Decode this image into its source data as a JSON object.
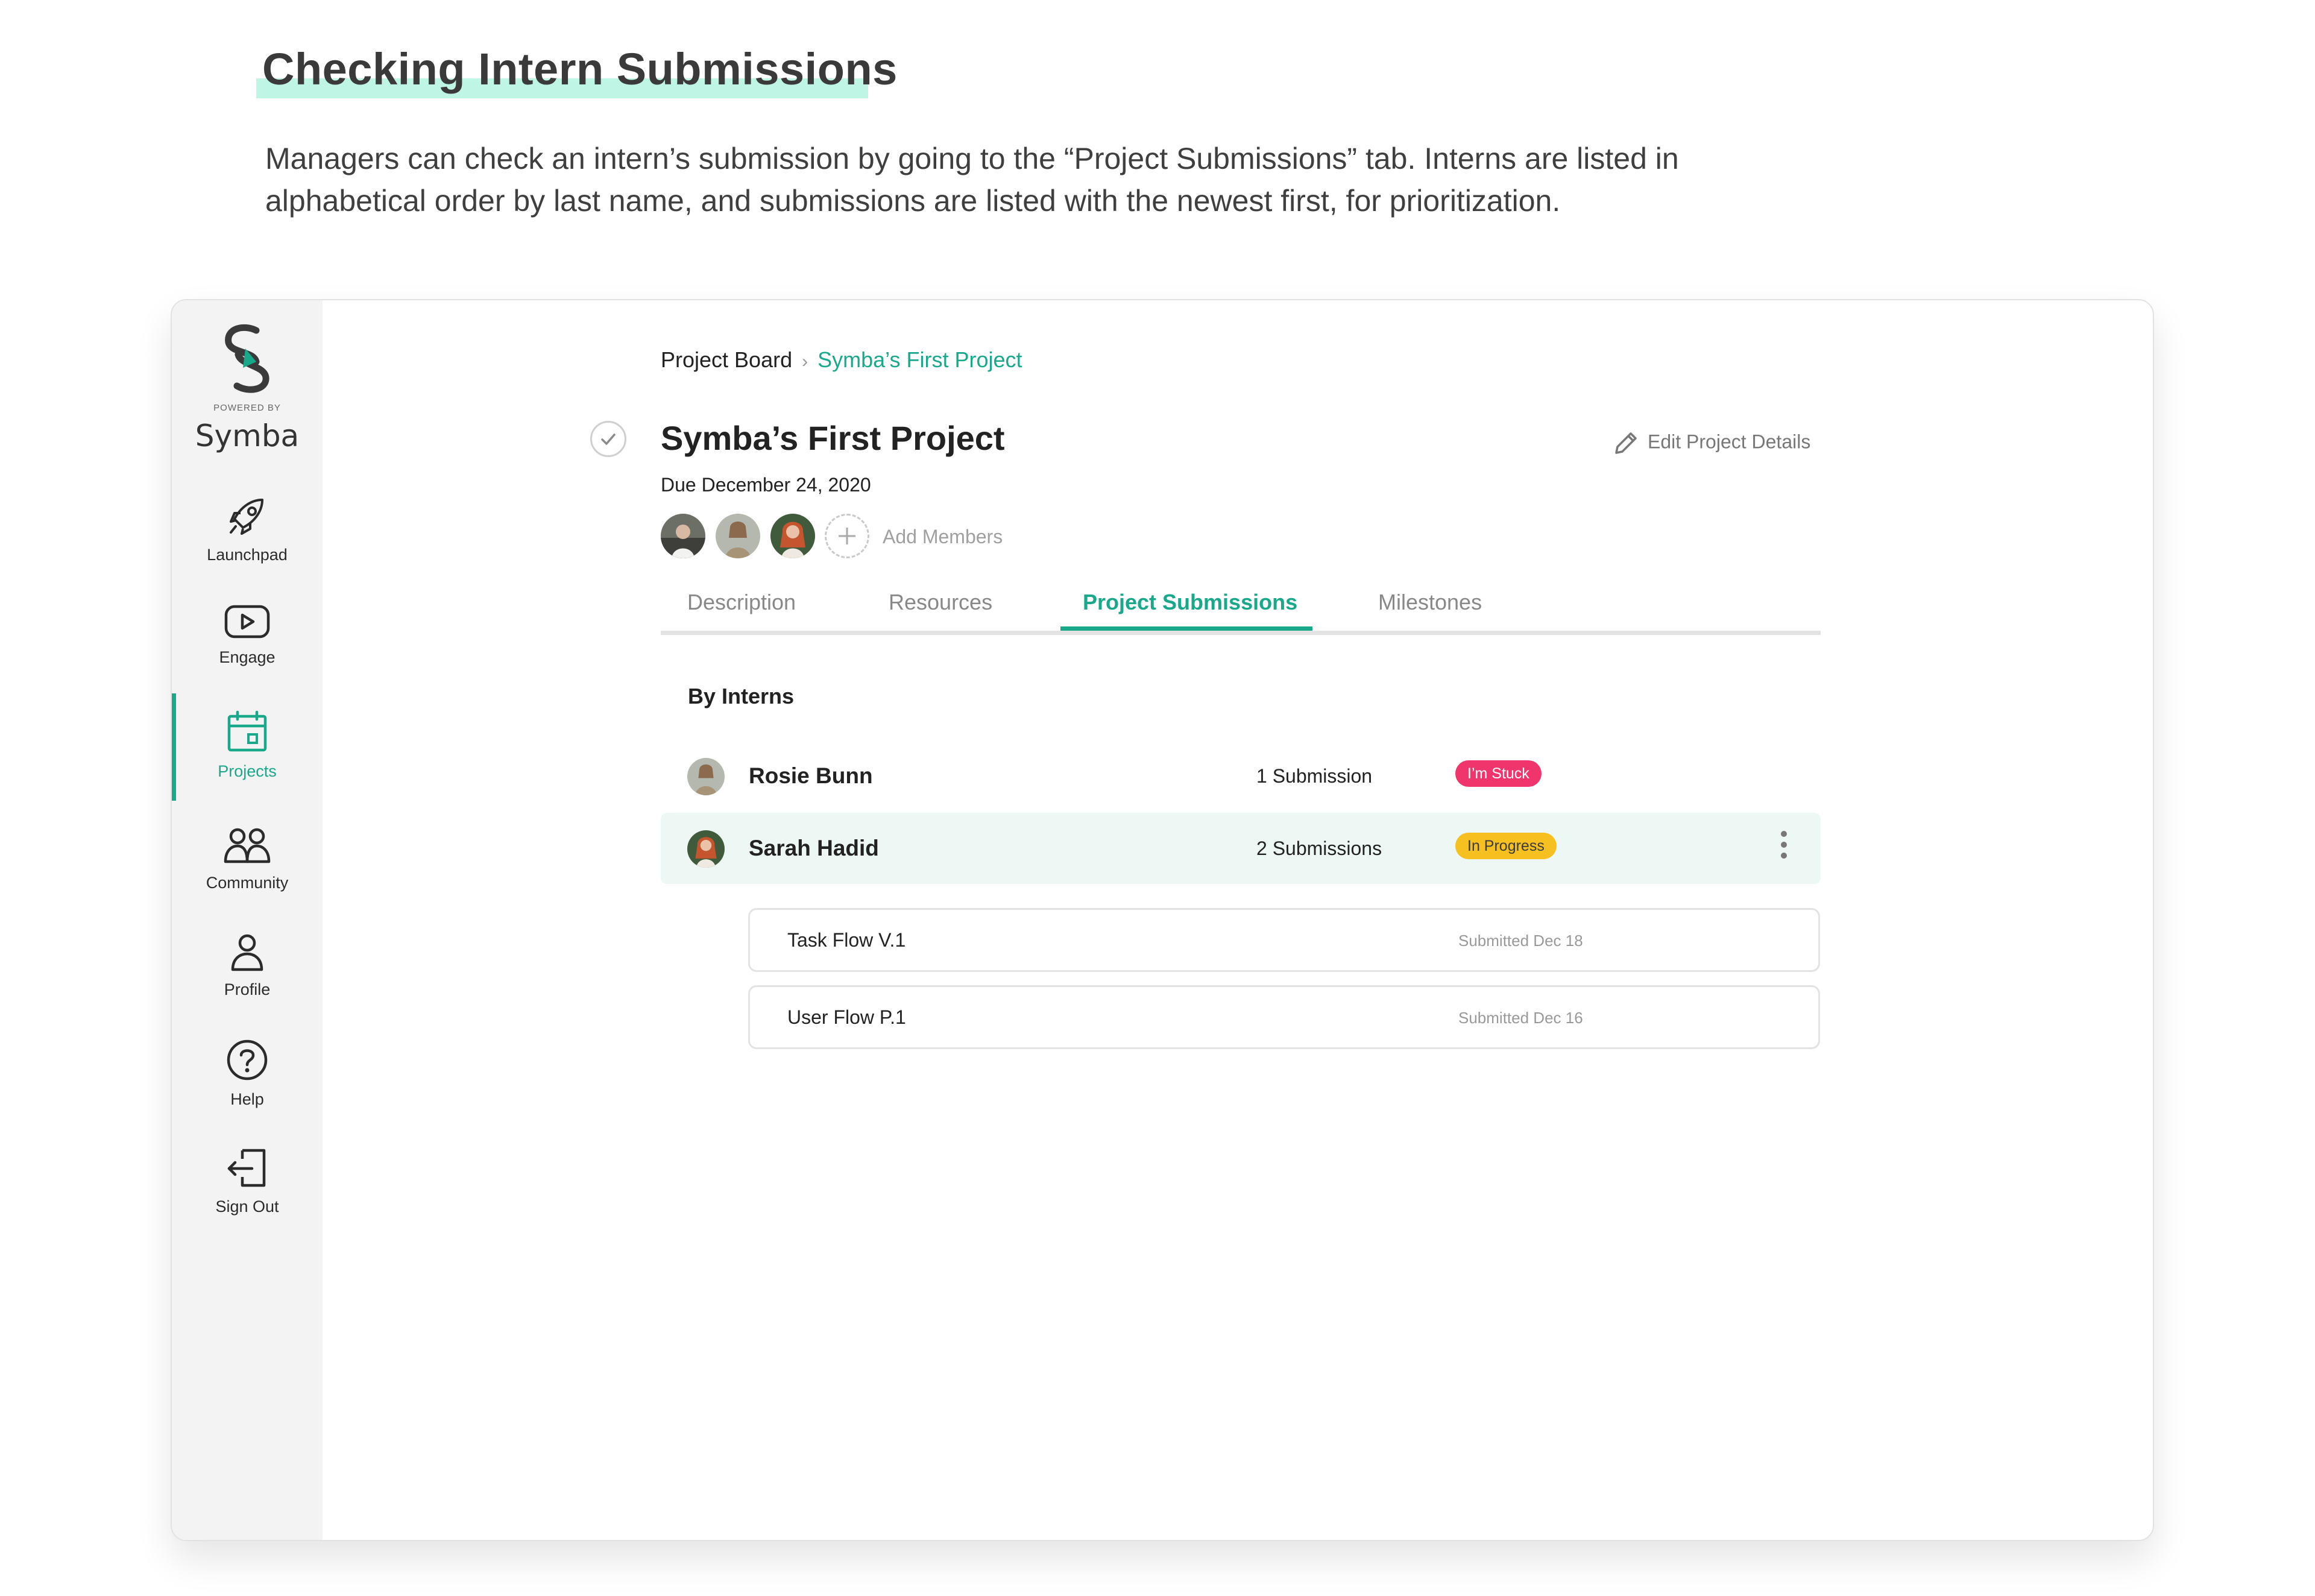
{
  "page": {
    "heading": "Checking Intern Submissions",
    "intro": "Managers can check an intern’s submission by going to the “Project Submissions” tab. Interns are listed in alphabetical order by last name, and submissions are listed with the newest first, for prioritization."
  },
  "sidebar": {
    "powered_by": "POWERED BY",
    "brand": "Symba",
    "items": [
      {
        "label": "Launchpad",
        "icon": "rocket-icon"
      },
      {
        "label": "Engage",
        "icon": "play-icon"
      },
      {
        "label": "Projects",
        "icon": "calendar-icon",
        "active": true
      },
      {
        "label": "Community",
        "icon": "people-icon"
      },
      {
        "label": "Profile",
        "icon": "person-icon"
      },
      {
        "label": "Help",
        "icon": "help-icon"
      },
      {
        "label": "Sign Out",
        "icon": "sign-out-icon"
      }
    ]
  },
  "breadcrumb": {
    "root": "Project Board",
    "current": "Symba’s First Project"
  },
  "project": {
    "title": "Symba’s First Project",
    "due": "Due December 24, 2020",
    "edit_label": "Edit Project Details",
    "add_members_label": "Add Members"
  },
  "tabs": [
    "Description",
    "Resources",
    "Project Submissions",
    "Milestones"
  ],
  "active_tab": "Project Submissions",
  "section_title": "By Interns",
  "interns": [
    {
      "name": "Rosie Bunn",
      "submissions": "1 Submission",
      "status": "I’m Stuck"
    },
    {
      "name": "Sarah Hadid",
      "submissions": "2 Submissions",
      "status": "In Progress"
    }
  ],
  "submissions": [
    {
      "name": "Task Flow V.1",
      "date": "Submitted Dec 18"
    },
    {
      "name": "User Flow P.1",
      "date": "Submitted Dec 16"
    }
  ],
  "colors": {
    "accent": "#19a98a",
    "stuck": "#f0356d",
    "progress": "#f7c021",
    "highlight": "#bff5e5"
  }
}
